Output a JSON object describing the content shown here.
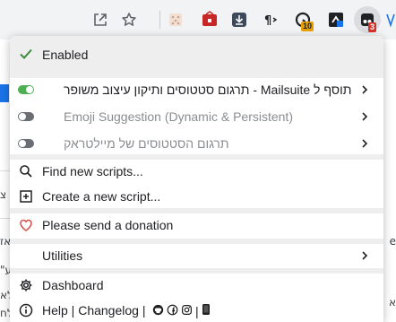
{
  "toolbar": {
    "extension_badges": {
      "ext3": "10",
      "ext5": "3"
    }
  },
  "background_page": {
    "right_texts": [
      "e",
      "א"
    ],
    "left_texts": [
      "צ",
      "אז",
      "\"ע",
      "לא",
      "לח"
    ]
  },
  "menu": {
    "enabled_label": "Enabled",
    "scripts": [
      {
        "name": "תרגום סטטוסים ותיקון עיצוב משופר - Mailsuite תוסף ל",
        "enabled": true
      },
      {
        "name": "Emoji Suggestion (Dynamic & Persistent)",
        "enabled": false
      },
      {
        "name": "תרגום הסטטוסים של מיילטראק",
        "enabled": false
      }
    ],
    "find_new_scripts": "Find new scripts...",
    "create_new_script": "Create a new script...",
    "donation": "Please send a donation",
    "utilities": "Utilities",
    "dashboard": "Dashboard",
    "help_links": "Help | Changelog |",
    "help_sep": "|"
  },
  "colors": {
    "check": "#3d8b40",
    "toggle_on": "#4caf50",
    "toggle_off": "#6b6e72",
    "heart": "#d9534f",
    "accent_blue": "#1a73e8"
  }
}
